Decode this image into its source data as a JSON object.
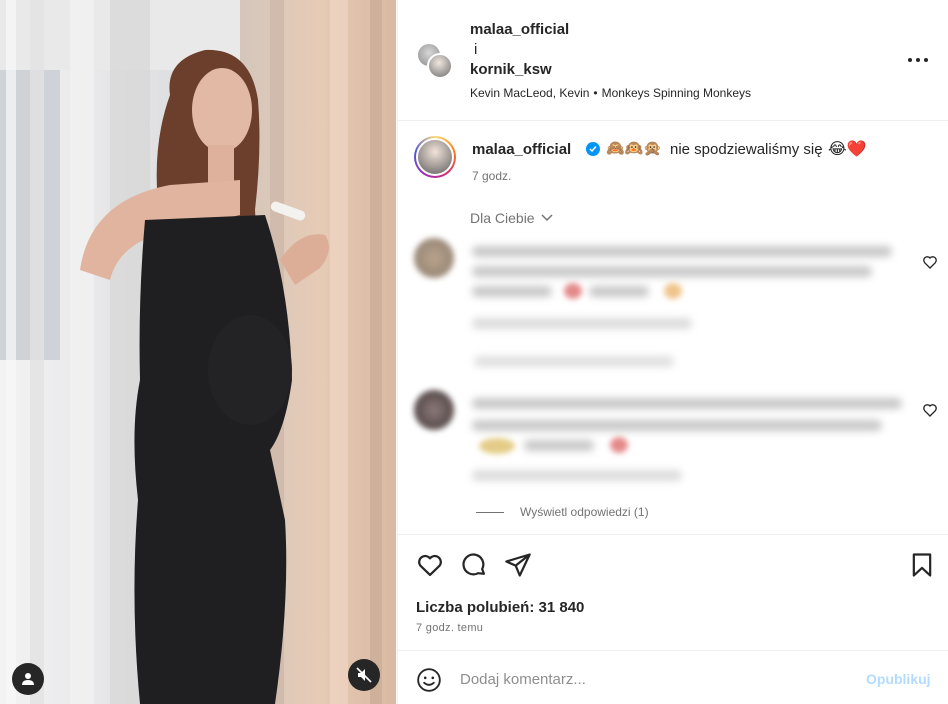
{
  "colors": {
    "text_primary": "#262626",
    "text_secondary": "#737373",
    "verified_blue": "#0095f6",
    "publish_disabled": "#b3dbff",
    "heart_red": "#ed4956"
  },
  "media": {
    "user_tags_icon": "person-icon",
    "mute_icon": "speaker-muted-icon"
  },
  "header": {
    "user1": "malaa_official",
    "and": "i",
    "user2": "kornik_ksw",
    "audio_artist": "Kevin MacLeod, Kevin",
    "audio_dot": "•",
    "audio_title": "Monkeys Spinning Monkeys",
    "more_icon": "more-options-icon"
  },
  "caption": {
    "username": "malaa_official",
    "emojis": "🙈🙉🙊",
    "text": "nie spodziewaliśmy się",
    "end_emojis": "😂❤️",
    "time": "7 godz."
  },
  "comments": {
    "filter_label": "Dla Ciebie",
    "view_replies": "Wyświetl odpowiedzi (1)"
  },
  "actions": {
    "likes": "Liczba polubień: 31 840",
    "time": "7 godz. temu"
  },
  "comment_bar": {
    "placeholder": "Dodaj komentarz...",
    "publish": "Opublikuj"
  }
}
